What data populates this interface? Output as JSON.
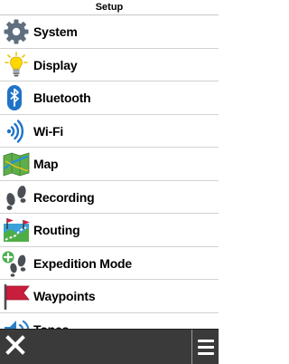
{
  "header": {
    "title": "Setup"
  },
  "menu": {
    "items": [
      {
        "label": "System",
        "icon": "gear-icon"
      },
      {
        "label": "Display",
        "icon": "lightbulb-icon"
      },
      {
        "label": "Bluetooth",
        "icon": "bluetooth-icon"
      },
      {
        "label": "Wi-Fi",
        "icon": "wifi-icon"
      },
      {
        "label": "Map",
        "icon": "map-icon"
      },
      {
        "label": "Recording",
        "icon": "footprints-icon"
      },
      {
        "label": "Routing",
        "icon": "routing-icon"
      },
      {
        "label": "Expedition Mode",
        "icon": "expedition-icon"
      },
      {
        "label": "Waypoints",
        "icon": "flag-icon"
      },
      {
        "label": "Tones",
        "icon": "tones-icon"
      }
    ]
  },
  "toolbar": {
    "close_icon": "close-icon",
    "menu_icon": "hamburger-menu-icon"
  },
  "colors": {
    "toolbar_background": "#3a3a3a",
    "gear": "#5f6f7f",
    "bluetooth": "#1e73c8",
    "flag": "#c81e3c"
  }
}
